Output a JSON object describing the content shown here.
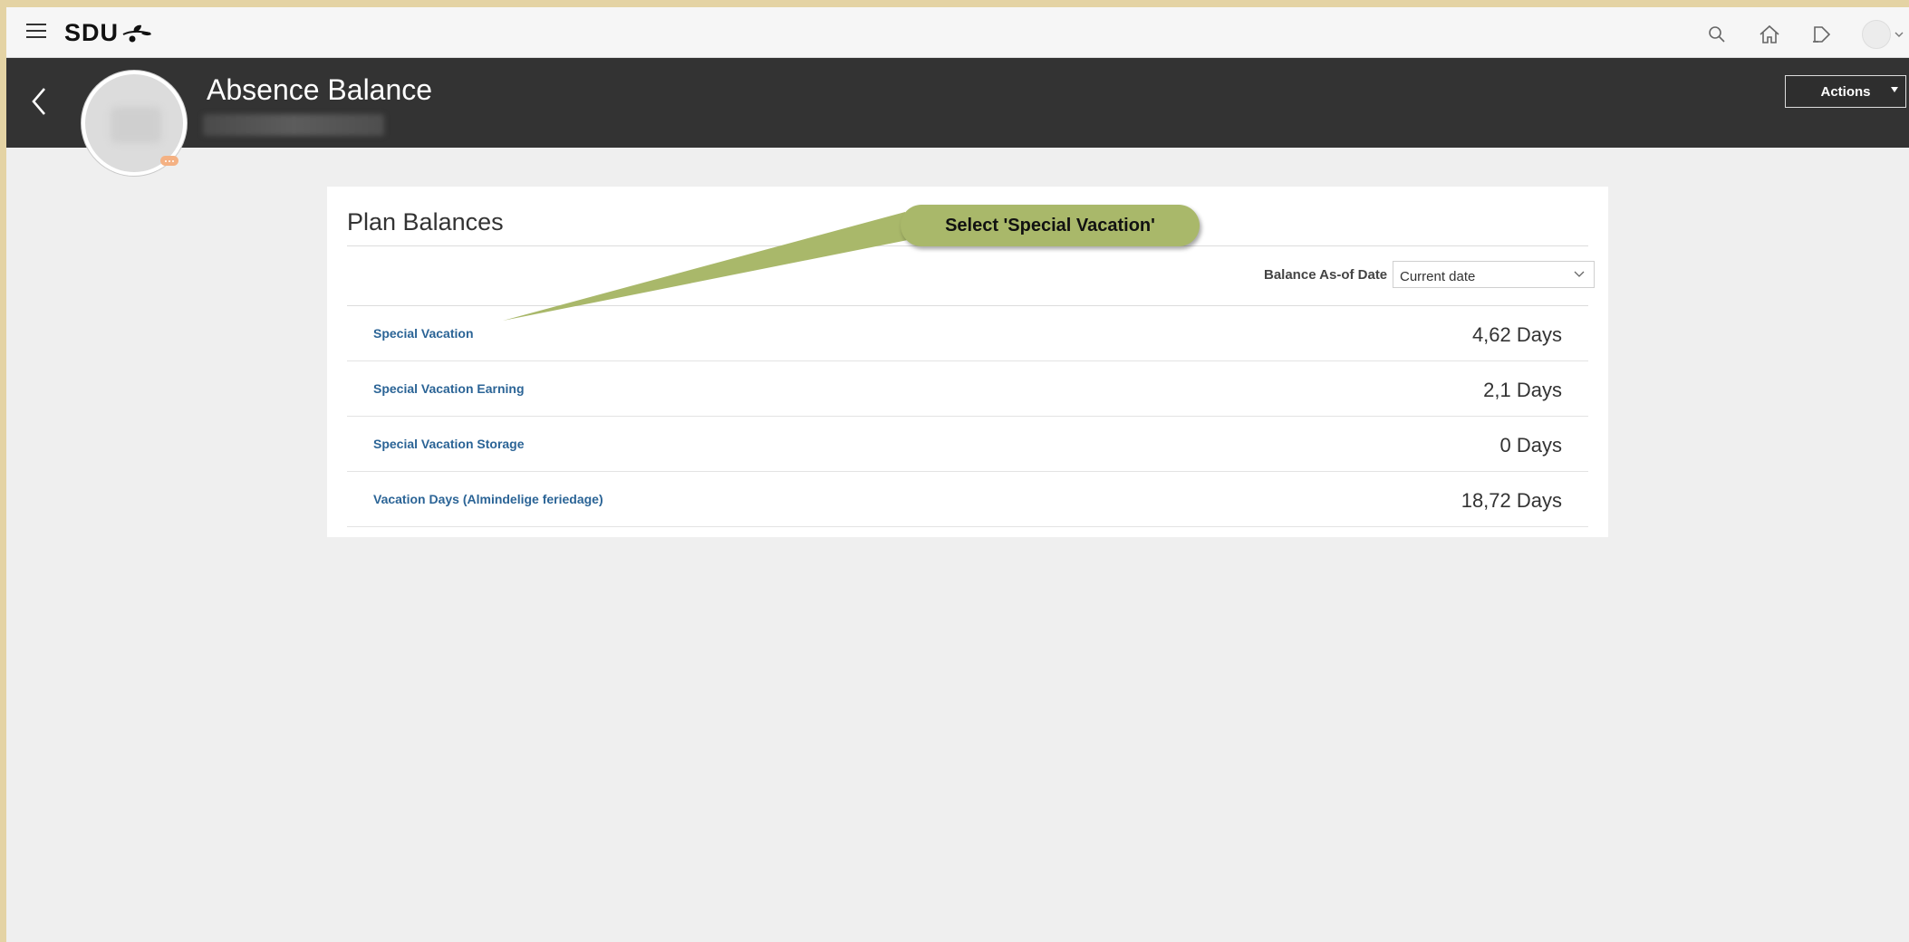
{
  "header": {
    "logo_text": "SDU",
    "icons": [
      "menu-icon",
      "search-icon",
      "home-icon",
      "notifications-icon",
      "user-avatar"
    ]
  },
  "page": {
    "title": "Absence Balance",
    "actions_label": "Actions"
  },
  "plan_balances": {
    "title": "Plan Balances",
    "as_of_label": "Balance As-of Date",
    "as_of_value": "Current date",
    "rows": [
      {
        "name": "Special Vacation",
        "value": "4,62 Days"
      },
      {
        "name": "Special Vacation Earning",
        "value": "2,1 Days"
      },
      {
        "name": "Special Vacation Storage",
        "value": "0 Days"
      },
      {
        "name": "Vacation Days (Almindelige feriedage)",
        "value": "18,72 Days"
      }
    ]
  },
  "callout": {
    "text": "Select 'Special Vacation'",
    "color": "#a9b86a"
  },
  "colors": {
    "header_band": "#333333",
    "link": "#2b6496",
    "outer_frame": "#e4d3a4"
  }
}
